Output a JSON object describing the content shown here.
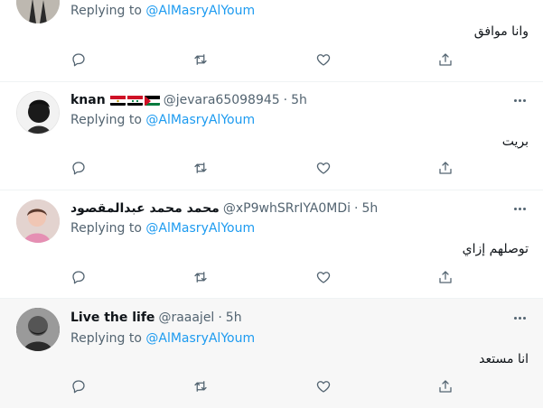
{
  "replying_prefix": "Replying to ",
  "tweets": [
    {
      "name": "",
      "handle": "",
      "time": "",
      "replying_to": "@AlMasryAlYoum",
      "text": "وانا موافق"
    },
    {
      "name": "knan",
      "flags": [
        "egypt-flag",
        "syria-flag",
        "palestine-flag"
      ],
      "handle": "@jevara65098945",
      "separator": "·",
      "time": "5h",
      "replying_to": "@AlMasryAlYoum",
      "text": "بريت"
    },
    {
      "name": "محمد محمد عبدالمقصود",
      "handle": "@xP9whSRrIYA0MDi",
      "separator": "·",
      "time": "5h",
      "replying_to": "@AlMasryAlYoum",
      "text": "توصلهم إزاي"
    },
    {
      "name": "Live the life",
      "handle": "@raaajel",
      "separator": "·",
      "time": "5h",
      "replying_to": "@AlMasryAlYoum",
      "text": "انا مستعد"
    }
  ],
  "action_icons": [
    "reply-icon",
    "retweet-icon",
    "like-icon",
    "share-icon"
  ],
  "colors": {
    "accent": "#1d9bf0",
    "secondary_text": "#536471",
    "highlight_bg": "#f7f7f7"
  }
}
